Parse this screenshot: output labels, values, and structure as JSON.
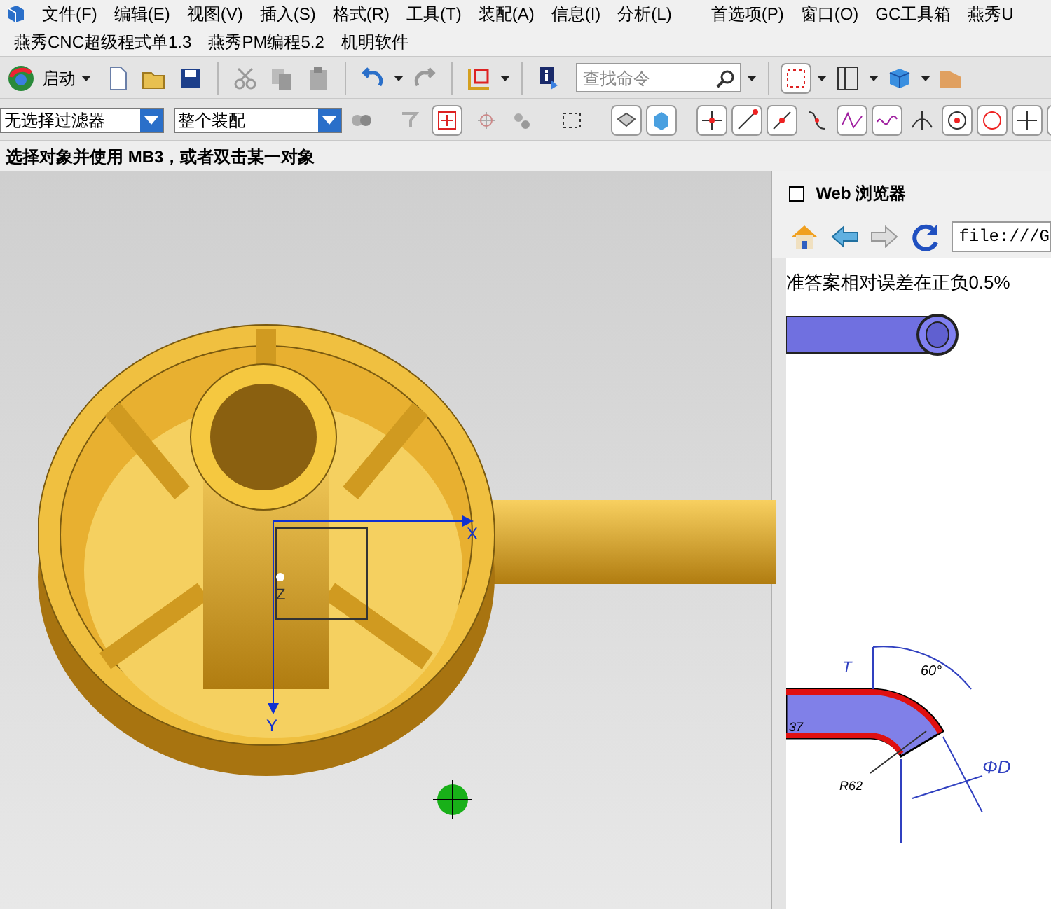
{
  "menu_bar": {
    "items": [
      "文件(F)",
      "编辑(E)",
      "视图(V)",
      "插入(S)",
      "格式(R)",
      "工具(T)",
      "装配(A)",
      "信息(I)",
      "分析(L)",
      "首选项(P)",
      "窗口(O)",
      "GC工具箱",
      "燕秀U"
    ],
    "items_row2": [
      "燕秀CNC超级程式单1.3",
      "燕秀PM编程5.2",
      "机明软件"
    ]
  },
  "toolbar": {
    "start_label": "启动",
    "search": {
      "placeholder": "查找命令"
    }
  },
  "selection_bar": {
    "filter": "无选择过滤器",
    "scope": "整个装配"
  },
  "prompt": "选择对象并使用 MB3，或者双击某一对象",
  "viewport": {
    "axis_labels": [
      "X",
      "Z",
      "Y"
    ]
  },
  "web_browser": {
    "title": "Web 浏览器",
    "checkbox_checked": false,
    "address": "file:///G",
    "content_text": "准答案相对误差在正负0.5%",
    "drawing_labels": [
      "T",
      "60°",
      "37",
      "R62",
      "ΦD"
    ]
  }
}
